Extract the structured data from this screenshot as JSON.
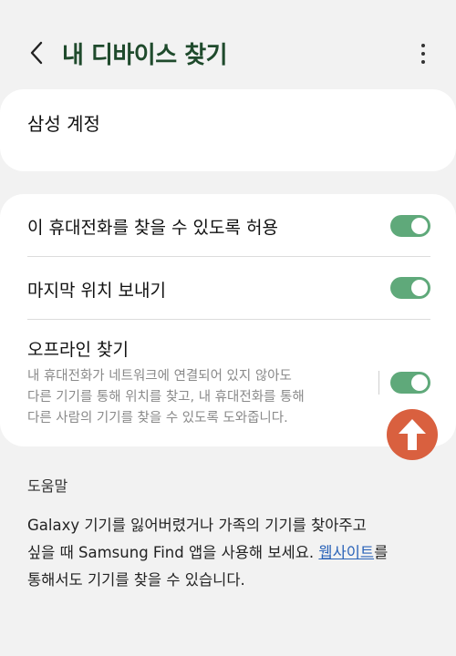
{
  "header": {
    "title": "내 디바이스 찾기"
  },
  "account": {
    "title": "삼성 계정"
  },
  "settings": {
    "allow_find": {
      "label": "이 휴대전화를 찾을 수 있도록 허용",
      "enabled": true
    },
    "send_last_location": {
      "label": "마지막 위치 보내기",
      "enabled": true
    },
    "offline_find": {
      "label": "오프라인 찾기",
      "description_lines": [
        "내 휴대전화가 네트워크에 연결되어 있지 않아도",
        "다른 기기를 통해 위치를 찾고, 내 휴대전화를 통해",
        "다른 사람의 기기를 찾을 수 있도록 도와줍니다."
      ],
      "enabled": true
    }
  },
  "help": {
    "title": "도움말",
    "line1": "Galaxy 기기를 잃어버렸거나 가족의 기기를 찾아주고",
    "line2_prefix": "싶을 때 Samsung Find 앱을 사용해 보세요. ",
    "link": "웹사이트",
    "line2_suffix": "를",
    "line3": "통해서도 기기를 찾을 수 있습니다."
  },
  "colors": {
    "accent": "#5fa97a",
    "title": "#1f4a2c",
    "fab": "#d9603f",
    "link": "#2a63b8"
  },
  "icons": {
    "back": "back-arrow-icon",
    "more": "more-options-icon",
    "fab": "arrow-up-icon"
  }
}
